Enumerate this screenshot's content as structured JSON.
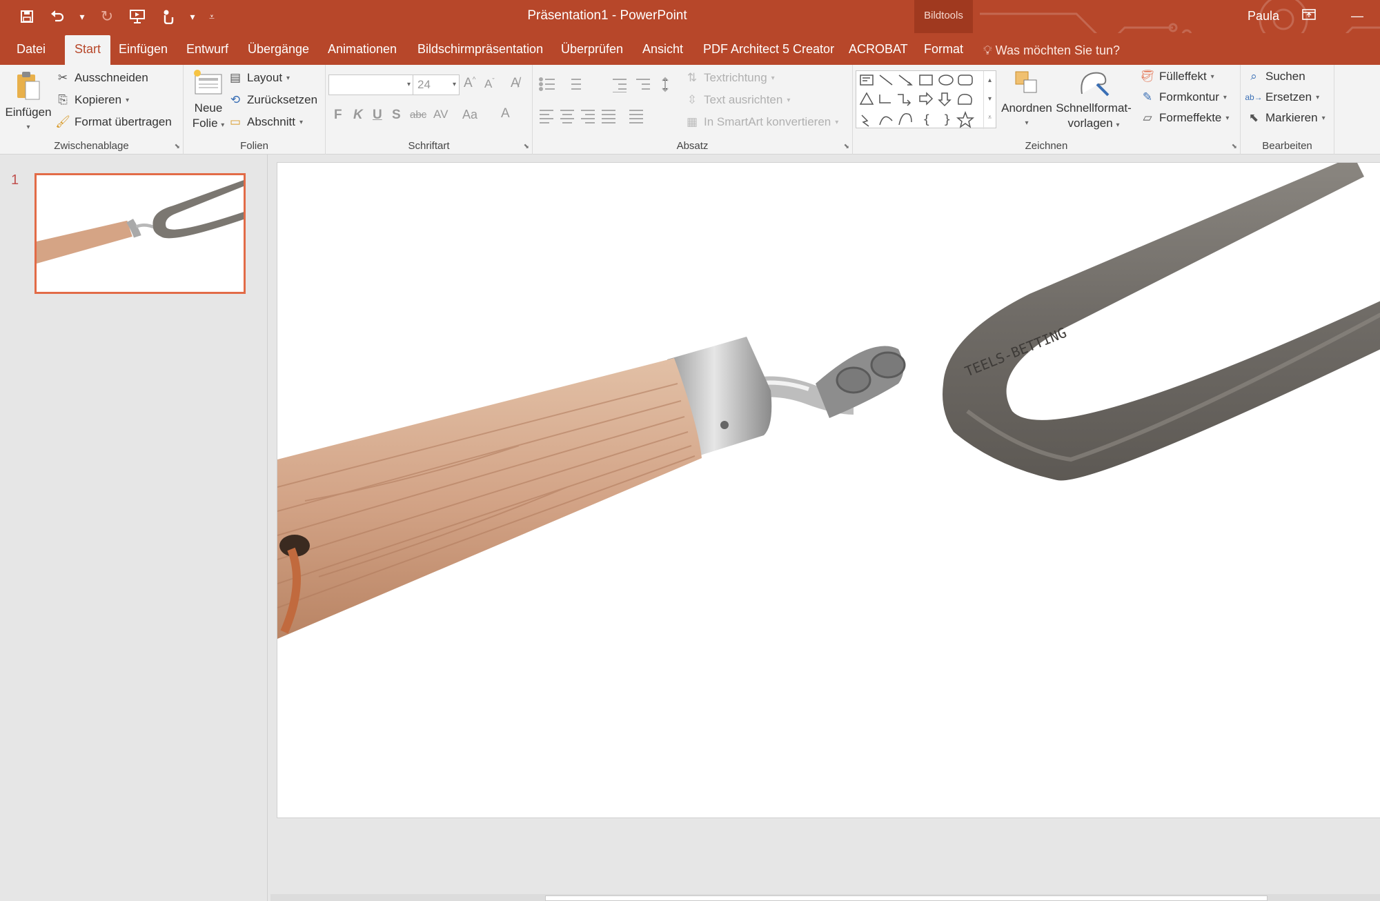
{
  "window": {
    "title": "Präsentation1  -  PowerPoint",
    "context_label": "Bildtools",
    "user": "Paula",
    "accent": "#b7472a"
  },
  "qat": {
    "icons": [
      "save-icon",
      "undo-icon",
      "redo-icon",
      "start-presentation-icon",
      "touch-mode-icon",
      "customize-qat-icon"
    ]
  },
  "tabs": [
    {
      "label": "Datei"
    },
    {
      "label": "Start"
    },
    {
      "label": "Einfügen"
    },
    {
      "label": "Entwurf"
    },
    {
      "label": "Übergänge"
    },
    {
      "label": "Animationen"
    },
    {
      "label": "Bildschirmpräsentation"
    },
    {
      "label": "Überprüfen"
    },
    {
      "label": "Ansicht"
    },
    {
      "label": "PDF Architect 5 Creator"
    },
    {
      "label": "ACROBAT"
    },
    {
      "label": "Format"
    }
  ],
  "tellme": "Was möchten Sie tun?",
  "ribbon": {
    "clipboard": {
      "label": "Zwischenablage",
      "paste": "Einfügen",
      "cut": "Ausschneiden",
      "copy": "Kopieren",
      "format_painter": "Format übertragen"
    },
    "slides": {
      "label": "Folien",
      "new_slide_1": "Neue",
      "new_slide_2": "Folie",
      "layout": "Layout",
      "reset": "Zurücksetzen",
      "section": "Abschnitt"
    },
    "font": {
      "label": "Schriftart",
      "font_name": "",
      "font_size": "24",
      "bold": "F",
      "italic": "K",
      "underline": "U",
      "shadow": "S",
      "strike": "abc",
      "spacing": "AV",
      "case": "Aa",
      "color": "A"
    },
    "paragraph": {
      "label": "Absatz",
      "text_direction": "Textrichtung",
      "align_text": "Text ausrichten",
      "smartart": "In SmartArt konvertieren"
    },
    "drawing": {
      "label": "Zeichnen",
      "arrange": "Anordnen",
      "quick_styles_1": "Schnellformat-",
      "quick_styles_2": "vorlagen",
      "fill": "Fülleffekt",
      "outline": "Formkontur",
      "effects": "Formeffekte"
    },
    "editing": {
      "label": "Bearbeiten",
      "find": "Suchen",
      "replace": "Ersetzen",
      "select": "Markieren"
    }
  },
  "slides_panel": {
    "slides": [
      {
        "number": "1"
      }
    ]
  }
}
